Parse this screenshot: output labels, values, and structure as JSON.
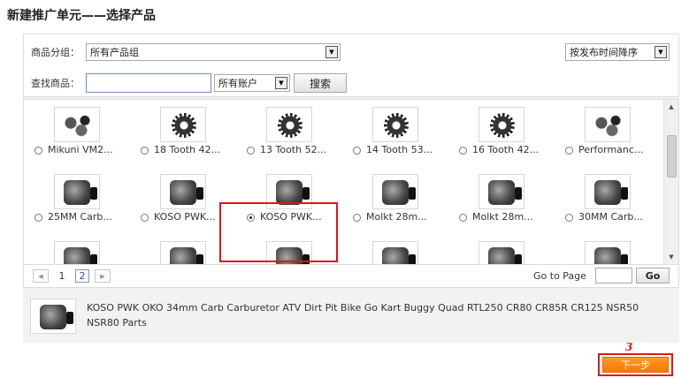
{
  "page": {
    "title": "新建推广单元——选择产品"
  },
  "filters": {
    "group_label": "商品分组：",
    "group_value": "所有产品组",
    "sort_value": "按发布时间降序",
    "search_label": "查找商品：",
    "search_value": "",
    "account_value": "所有账户",
    "search_button": "搜索"
  },
  "products": [
    {
      "label": "Mikuni VM2...",
      "icon": "kit",
      "selected": false
    },
    {
      "label": "18 Tooth 42...",
      "icon": "sprocket",
      "selected": false
    },
    {
      "label": "13 Tooth 52...",
      "icon": "sprocket",
      "selected": false
    },
    {
      "label": "14 Tooth 53...",
      "icon": "sprocket",
      "selected": false
    },
    {
      "label": "16 Tooth 42...",
      "icon": "sprocket",
      "selected": false
    },
    {
      "label": "Performanc...",
      "icon": "kit",
      "selected": false
    },
    {
      "label": "25MM Carb...",
      "icon": "carburetor",
      "selected": false
    },
    {
      "label": "KOSO PWK...",
      "icon": "carburetor",
      "selected": false
    },
    {
      "label": "KOSO PWK...",
      "icon": "carburetor",
      "selected": true
    },
    {
      "label": "Molkt 28m...",
      "icon": "carburetor",
      "selected": false
    },
    {
      "label": "Molkt 28m...",
      "icon": "carburetor",
      "selected": false
    },
    {
      "label": "30MM Carb...",
      "icon": "carburetor",
      "selected": false
    },
    {
      "label": "",
      "icon": "carburetor",
      "selected": false
    },
    {
      "label": "",
      "icon": "carburetor",
      "selected": false
    },
    {
      "label": "",
      "icon": "carburetor",
      "selected": false
    },
    {
      "label": "",
      "icon": "carburetor",
      "selected": false
    },
    {
      "label": "",
      "icon": "carburetor",
      "selected": false
    },
    {
      "label": "",
      "icon": "carburetor",
      "selected": false
    }
  ],
  "pagination": {
    "prev_icon": "chevron-left-icon",
    "next_icon": "chevron-right-icon",
    "pages": [
      "1",
      "2"
    ],
    "current": "2",
    "goto_label": "Go to Page",
    "go_button": "Go"
  },
  "selected_product": {
    "title": "KOSO PWK OKO 34mm Carb Carburetor ATV Dirt Pit Bike Go Kart Buggy Quad RTL250 CR80 CR85R CR125 NSR50 NSR80 Parts"
  },
  "actions": {
    "step_marker": "3",
    "next_button": "下一步"
  },
  "colors": {
    "highlight": "#e0151a",
    "next_button": "#f47a00",
    "input_border": "#6a8dc9"
  }
}
